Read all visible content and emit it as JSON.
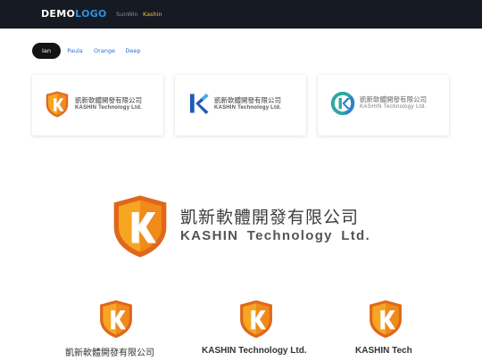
{
  "navbar": {
    "brand_part1": "DEMO",
    "brand_part2": "LOGO",
    "links": [
      "SunWin",
      "Kashin"
    ],
    "active_link": "Kashin"
  },
  "tabs": [
    "Ian",
    "Paula",
    "Orange",
    "Deep"
  ],
  "active_tab": "Ian",
  "logo": {
    "letter": "K",
    "chinese_name": "凱新軟體開發有限公司",
    "english_name": "KASHIN Technology Ltd.",
    "english_short": "KASHIN Tech"
  },
  "colors": {
    "navbar_bg": "#161a23",
    "brand_accent": "#2f8fe0",
    "active_link": "#f3c623",
    "shield_orange": "#f39a1e",
    "shield_dark": "#e0671b",
    "blue_k": "#1e5bb8",
    "teal_ks": "#2ea7a0"
  }
}
